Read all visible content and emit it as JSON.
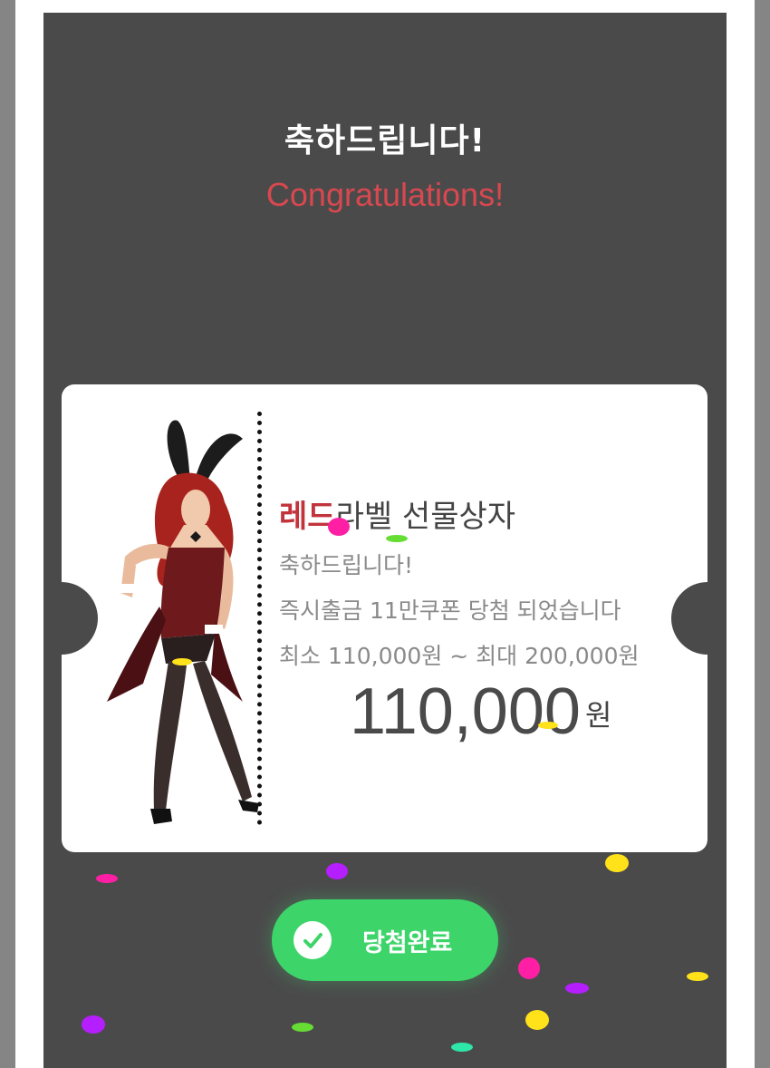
{
  "popup": {
    "title_ko": "축하드립니다!",
    "title_en": "Congratulations!"
  },
  "ticket": {
    "prize_name_accent": "레드",
    "prize_name_rest": "라벨 선물상자",
    "line1": "축하드립니다!",
    "line2": "즉시출금 11만쿠폰 당첨 되었습니다",
    "line3": "최소 110,000원 ~ 최대 200,000원",
    "amount": "110,000",
    "unit": "원",
    "image": "bunny-character-illustration"
  },
  "button": {
    "label": "당첨완료",
    "icon": "check-icon"
  },
  "colors": {
    "modal_bg": "#4b4a4b",
    "accent_red": "#d8484f",
    "button_green": "#3dd46a"
  }
}
